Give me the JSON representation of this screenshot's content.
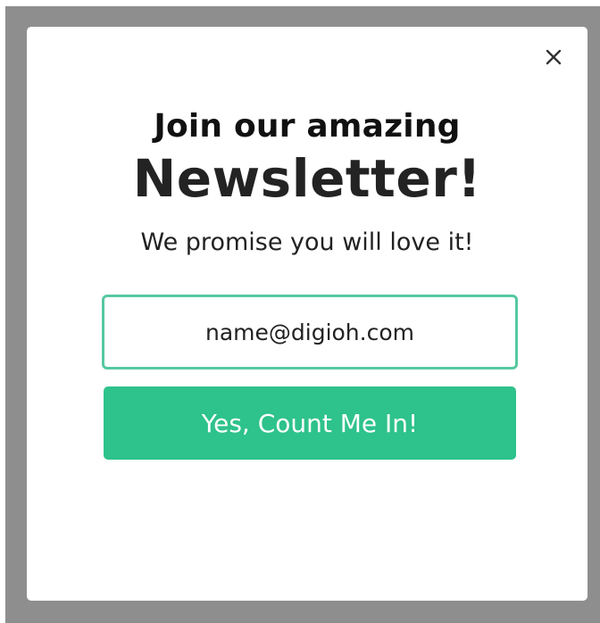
{
  "colors": {
    "overlay": "#8e8e8e",
    "modal_background": "#ffffff",
    "accent": "#2ec28c",
    "input_border": "#56c9a0",
    "heading_text": "#222322"
  },
  "modal": {
    "close_icon": "close-icon",
    "heading_small": "Join our amazing",
    "heading_big": "Newsletter!",
    "subheading": "We promise you will love it!",
    "email_placeholder": "name@digioh.com",
    "email_value": "",
    "submit_label": "Yes, Count Me In!"
  }
}
